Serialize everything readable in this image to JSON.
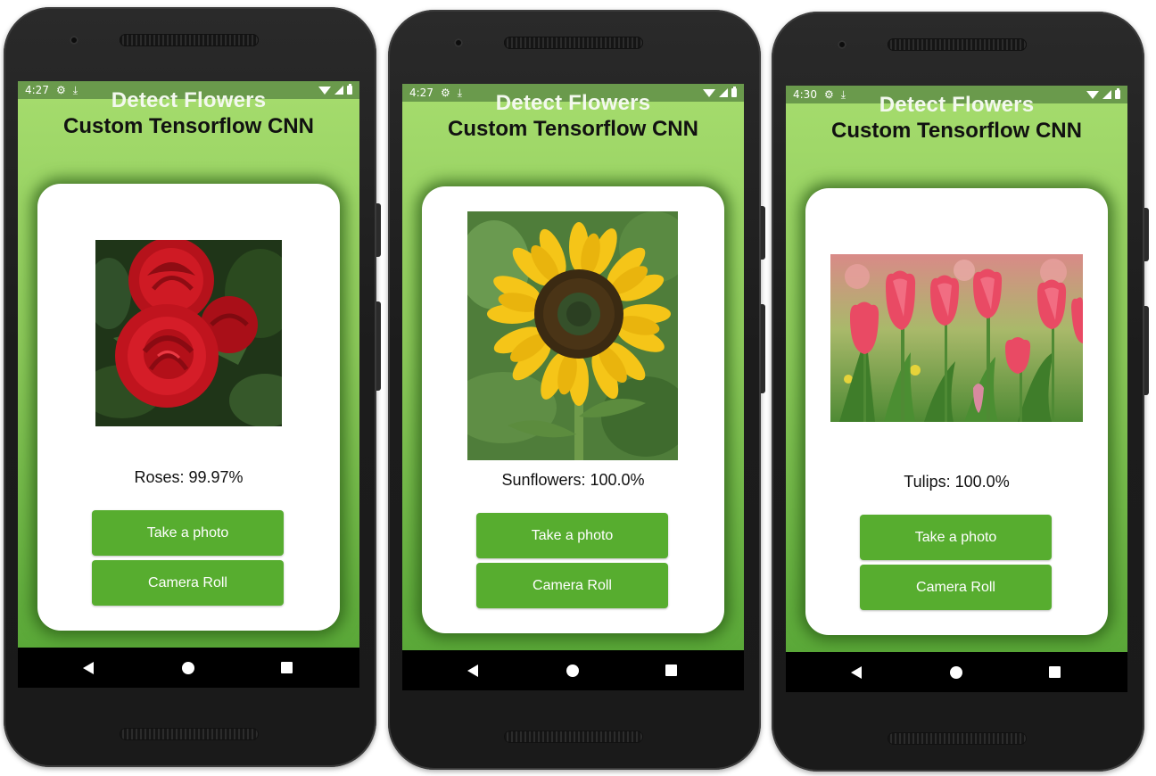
{
  "phones": [
    {
      "status": {
        "time": "4:27"
      },
      "app": {
        "title_line1": "Detect Flowers",
        "title_line2": "Custom Tensorflow CNN",
        "result": "Roses: 99.97%",
        "image": "rose-photo",
        "buttons": {
          "take_photo": "Take a photo",
          "camera_roll": "Camera Roll"
        }
      }
    },
    {
      "status": {
        "time": "4:27"
      },
      "app": {
        "title_line1": "Detect Flowers",
        "title_line2": "Custom Tensorflow CNN",
        "result": "Sunflowers: 100.0%",
        "image": "sunflower-photo",
        "buttons": {
          "take_photo": "Take a photo",
          "camera_roll": "Camera Roll"
        }
      }
    },
    {
      "status": {
        "time": "4:30"
      },
      "app": {
        "title_line1": "Detect Flowers",
        "title_line2": "Custom Tensorflow CNN",
        "result": "Tulips: 100.0%",
        "image": "tulips-photo",
        "buttons": {
          "take_photo": "Take a photo",
          "camera_roll": "Camera Roll"
        }
      }
    }
  ],
  "theme": {
    "accent_green": "#57ad2f",
    "background_top": "#a4db6c",
    "background_bottom": "#5aa838",
    "status_bar": "#6a9a4c"
  },
  "icons": {
    "status_left": [
      "settings-icon",
      "download-icon"
    ],
    "status_right": [
      "wifi-icon",
      "signal-icon",
      "battery-icon"
    ],
    "nav": [
      "back-icon",
      "home-icon",
      "recents-icon"
    ]
  }
}
